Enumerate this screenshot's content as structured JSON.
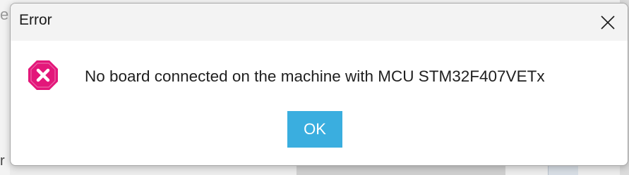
{
  "background": {
    "left_fragment_top": "e",
    "left_fragment_bottom": "r"
  },
  "dialog": {
    "title": "Error",
    "close_icon": "close-icon",
    "error_icon": "error-octagon-icon",
    "message": "No board connected on the machine with MCU STM32F407VETx",
    "ok_label": "OK"
  },
  "colors": {
    "accent_button": "#3aaedf",
    "error_icon": "#e3177a",
    "titlebar": "#f3f3f3"
  }
}
